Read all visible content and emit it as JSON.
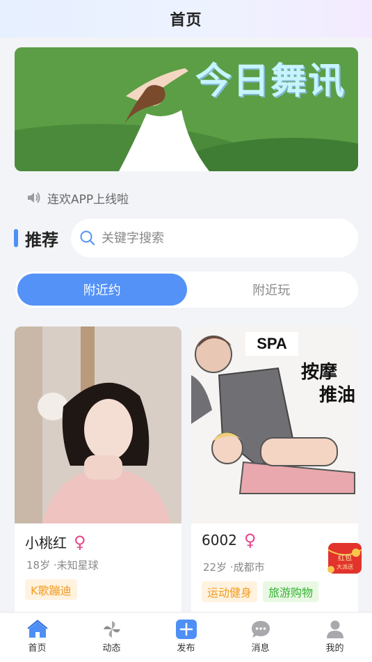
{
  "header": {
    "title": "首页"
  },
  "banner": {
    "title": "今日舞讯"
  },
  "notice": {
    "text": "连欢APP上线啦",
    "icon": "speaker-icon"
  },
  "section": {
    "title": "推荐"
  },
  "search": {
    "placeholder": "关键字搜索",
    "value": ""
  },
  "tabs": [
    {
      "label": "附近约",
      "active": true
    },
    {
      "label": "附近玩",
      "active": false
    }
  ],
  "cards": [
    {
      "name": "小桃红",
      "gender": "♀",
      "age": "18岁",
      "location": "·未知星球",
      "tags": [
        "K歌蹦迪"
      ]
    },
    {
      "name": "6002",
      "gender": "♀",
      "age": "22岁",
      "location": "·成都市",
      "tags": [
        "运动健身",
        "旅游购物"
      ],
      "image_text": {
        "badge": "SPA",
        "line1": "按摩",
        "line2": "推油"
      }
    }
  ],
  "redpacket": {
    "line1": "红包",
    "line2": "大派送"
  },
  "nav": [
    {
      "label": "首页",
      "icon": "home-icon",
      "active": true
    },
    {
      "label": "动态",
      "icon": "pinwheel-icon",
      "active": false
    },
    {
      "label": "发布",
      "icon": "plus-icon",
      "active": false
    },
    {
      "label": "消息",
      "icon": "chat-icon",
      "active": false
    },
    {
      "label": "我的",
      "icon": "user-icon",
      "active": false
    }
  ],
  "colors": {
    "accent": "#5492f7",
    "female": "#e8478c",
    "tag_orange": "#f29a1d",
    "tag_green": "#34b233"
  }
}
